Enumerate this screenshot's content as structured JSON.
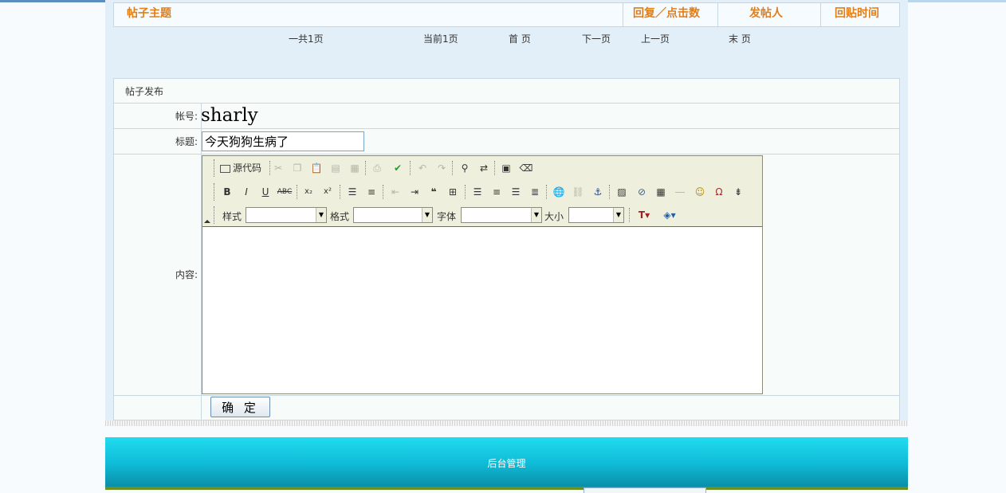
{
  "table_header": {
    "topic": "帖子主题",
    "reply_click": "回复／点击数",
    "poster": "发帖人",
    "reply_time": "回贴时间"
  },
  "pager": {
    "total": "一共1页",
    "current": "当前1页",
    "first": "首  页",
    "next": "下一页",
    "prev": "上一页",
    "last": "末  页"
  },
  "post_form": {
    "title": "帖子发布",
    "account_label": "帐号:",
    "account_value": "sharly",
    "subject_label": "标题:",
    "subject_value": "今天狗狗生病了",
    "content_label": "内容:",
    "submit_label": "确  定"
  },
  "editor": {
    "source_label": "源代码",
    "style_label": "样式",
    "format_label": "格式",
    "font_label": "字体",
    "size_label": "大小",
    "style_value": "",
    "format_value": "",
    "font_value": "",
    "size_value": "",
    "content": ""
  },
  "footer": {
    "admin_link": "后台管理"
  },
  "colors": {
    "header_text": "#e27e18",
    "footer_bg": "#14c4dc",
    "page_bg": "#e2eff8"
  }
}
